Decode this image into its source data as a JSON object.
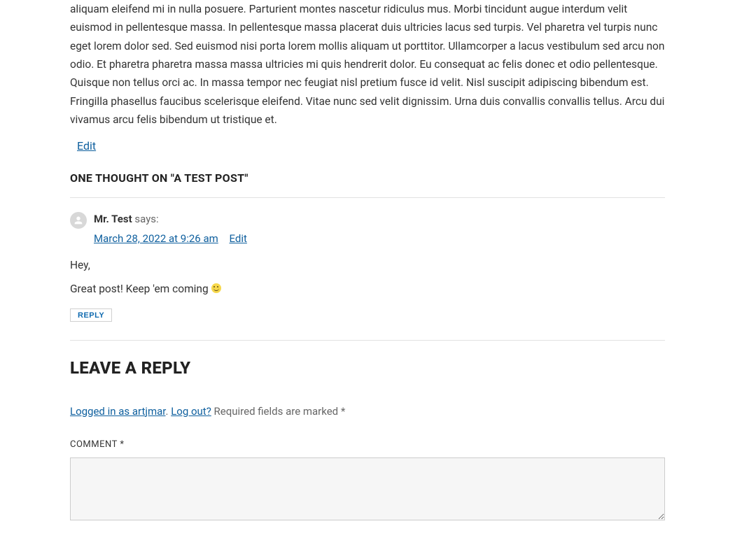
{
  "post": {
    "body_excerpt": "aliquam eleifend mi in nulla posuere. Parturient montes nascetur ridiculus mus. Morbi tincidunt augue interdum velit euismod in pellentesque massa. In pellentesque massa placerat duis ultricies lacus sed turpis. Vel pharetra vel turpis nunc eget lorem dolor sed. Sed euismod nisi porta lorem mollis aliquam ut porttitor. Ullamcorper a lacus vestibulum sed arcu non odio. Et pharetra pharetra massa massa ultricies mi quis hendrerit dolor. Eu consequat ac felis donec et odio pellentesque. Quisque non tellus orci ac. In massa tempor nec feugiat nisl pretium fusce id velit. Nisl suscipit adipiscing bibendum est. Fringilla phasellus faucibus scelerisque eleifend. Vitae nunc sed velit dignissim. Urna duis convallis convallis tellus. Arcu dui vivamus arcu felis bibendum ut tristique et.",
    "edit_label": "Edit"
  },
  "comments": {
    "title_prefix": "ONE THOUGHT ON \"",
    "title_post": "A TEST POST",
    "title_suffix": "\"",
    "comment": {
      "author": "Mr. Test",
      "says": "says:",
      "date": "March 28, 2022 at 9:26 am",
      "edit_label": "Edit",
      "body_line1": "Hey,",
      "body_line2_pre": "Great post! Keep 'em coming ",
      "reply_label": "REPLY"
    }
  },
  "reply_form": {
    "heading": "LEAVE A REPLY",
    "logged_in_text": "Logged in as artjmar",
    "logout_text": "Log out?",
    "required_text": "Required fields are marked ",
    "asterisk": "*",
    "period": ". ",
    "comment_label": "COMMENT ",
    "comment_value": ""
  }
}
